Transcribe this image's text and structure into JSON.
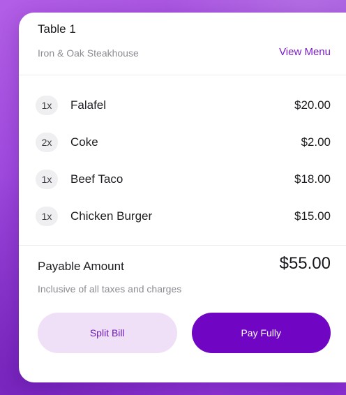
{
  "header": {
    "table_title": "Table 1",
    "restaurant_name": "Iron & Oak Steakhouse",
    "view_menu_label": "View Menu"
  },
  "order": {
    "items": [
      {
        "qty": "1x",
        "name": "Falafel",
        "price": "$20.00"
      },
      {
        "qty": "2x",
        "name": "Coke",
        "price": "$2.00"
      },
      {
        "qty": "1x",
        "name": "Beef Taco",
        "price": "$18.00"
      },
      {
        "qty": "1x",
        "name": "Chicken Burger",
        "price": "$15.00"
      }
    ]
  },
  "summary": {
    "payable_label": "Payable Amount",
    "payable_amount": "$55.00",
    "tax_note": "Inclusive of all taxes and charges"
  },
  "actions": {
    "split_bill_label": "Split Bill",
    "pay_fully_label": "Pay Fully"
  },
  "colors": {
    "accent": "#7105c4",
    "accent_light": "#efe0f7",
    "background_gradient_start": "#b35fe6",
    "background_gradient_end": "#8a2fd2"
  }
}
